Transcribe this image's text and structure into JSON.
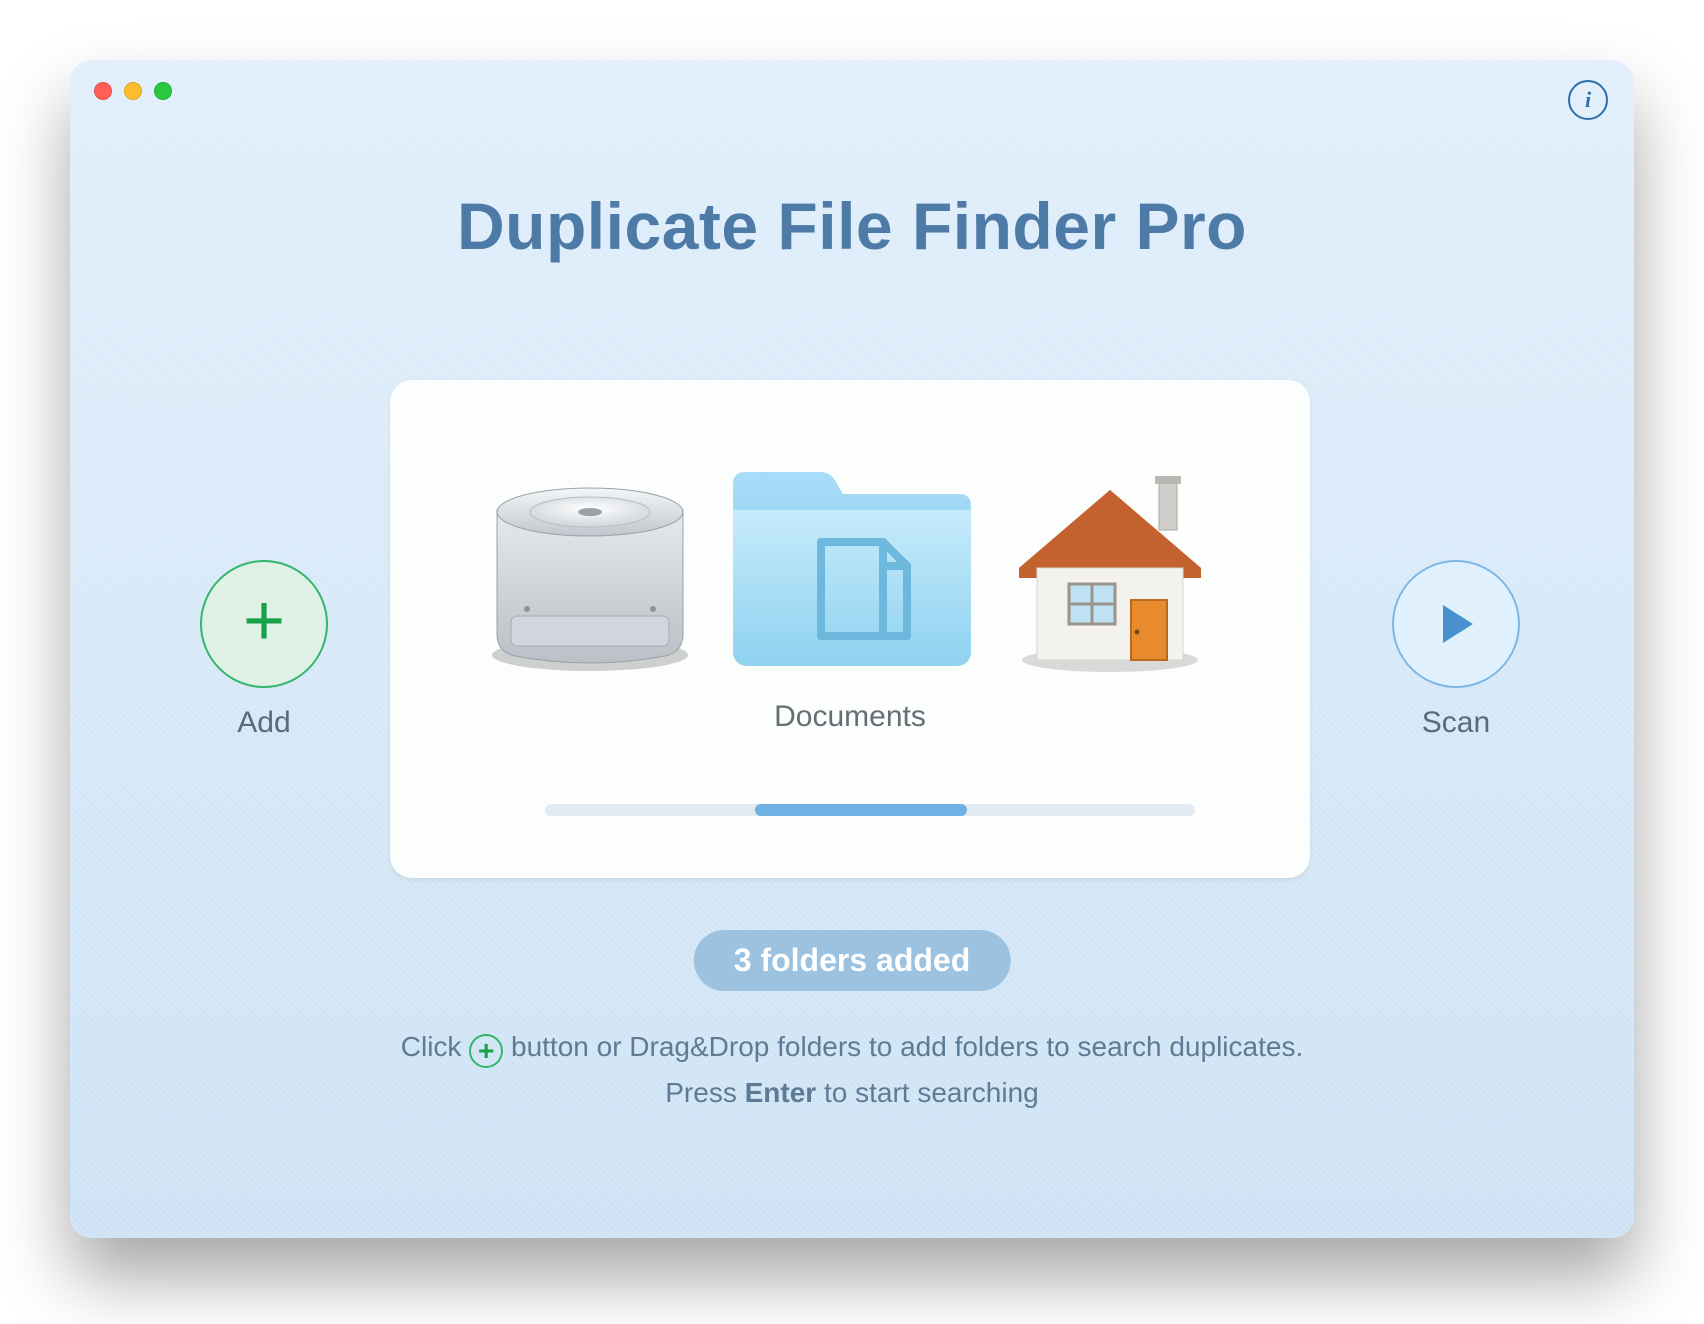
{
  "title": "Duplicate File Finder Pro",
  "add_label": "Add",
  "scan_label": "Scan",
  "selected_label": "Documents",
  "pill": "3 folders added",
  "hint1_a": "Click ",
  "hint1_b": " button or Drag&Drop folders to add folders to search duplicates.",
  "hint2_a": "Press ",
  "hint2_b": "Enter",
  "hint2_c": " to start searching",
  "info_glyph": "i",
  "plus_glyph": "+"
}
